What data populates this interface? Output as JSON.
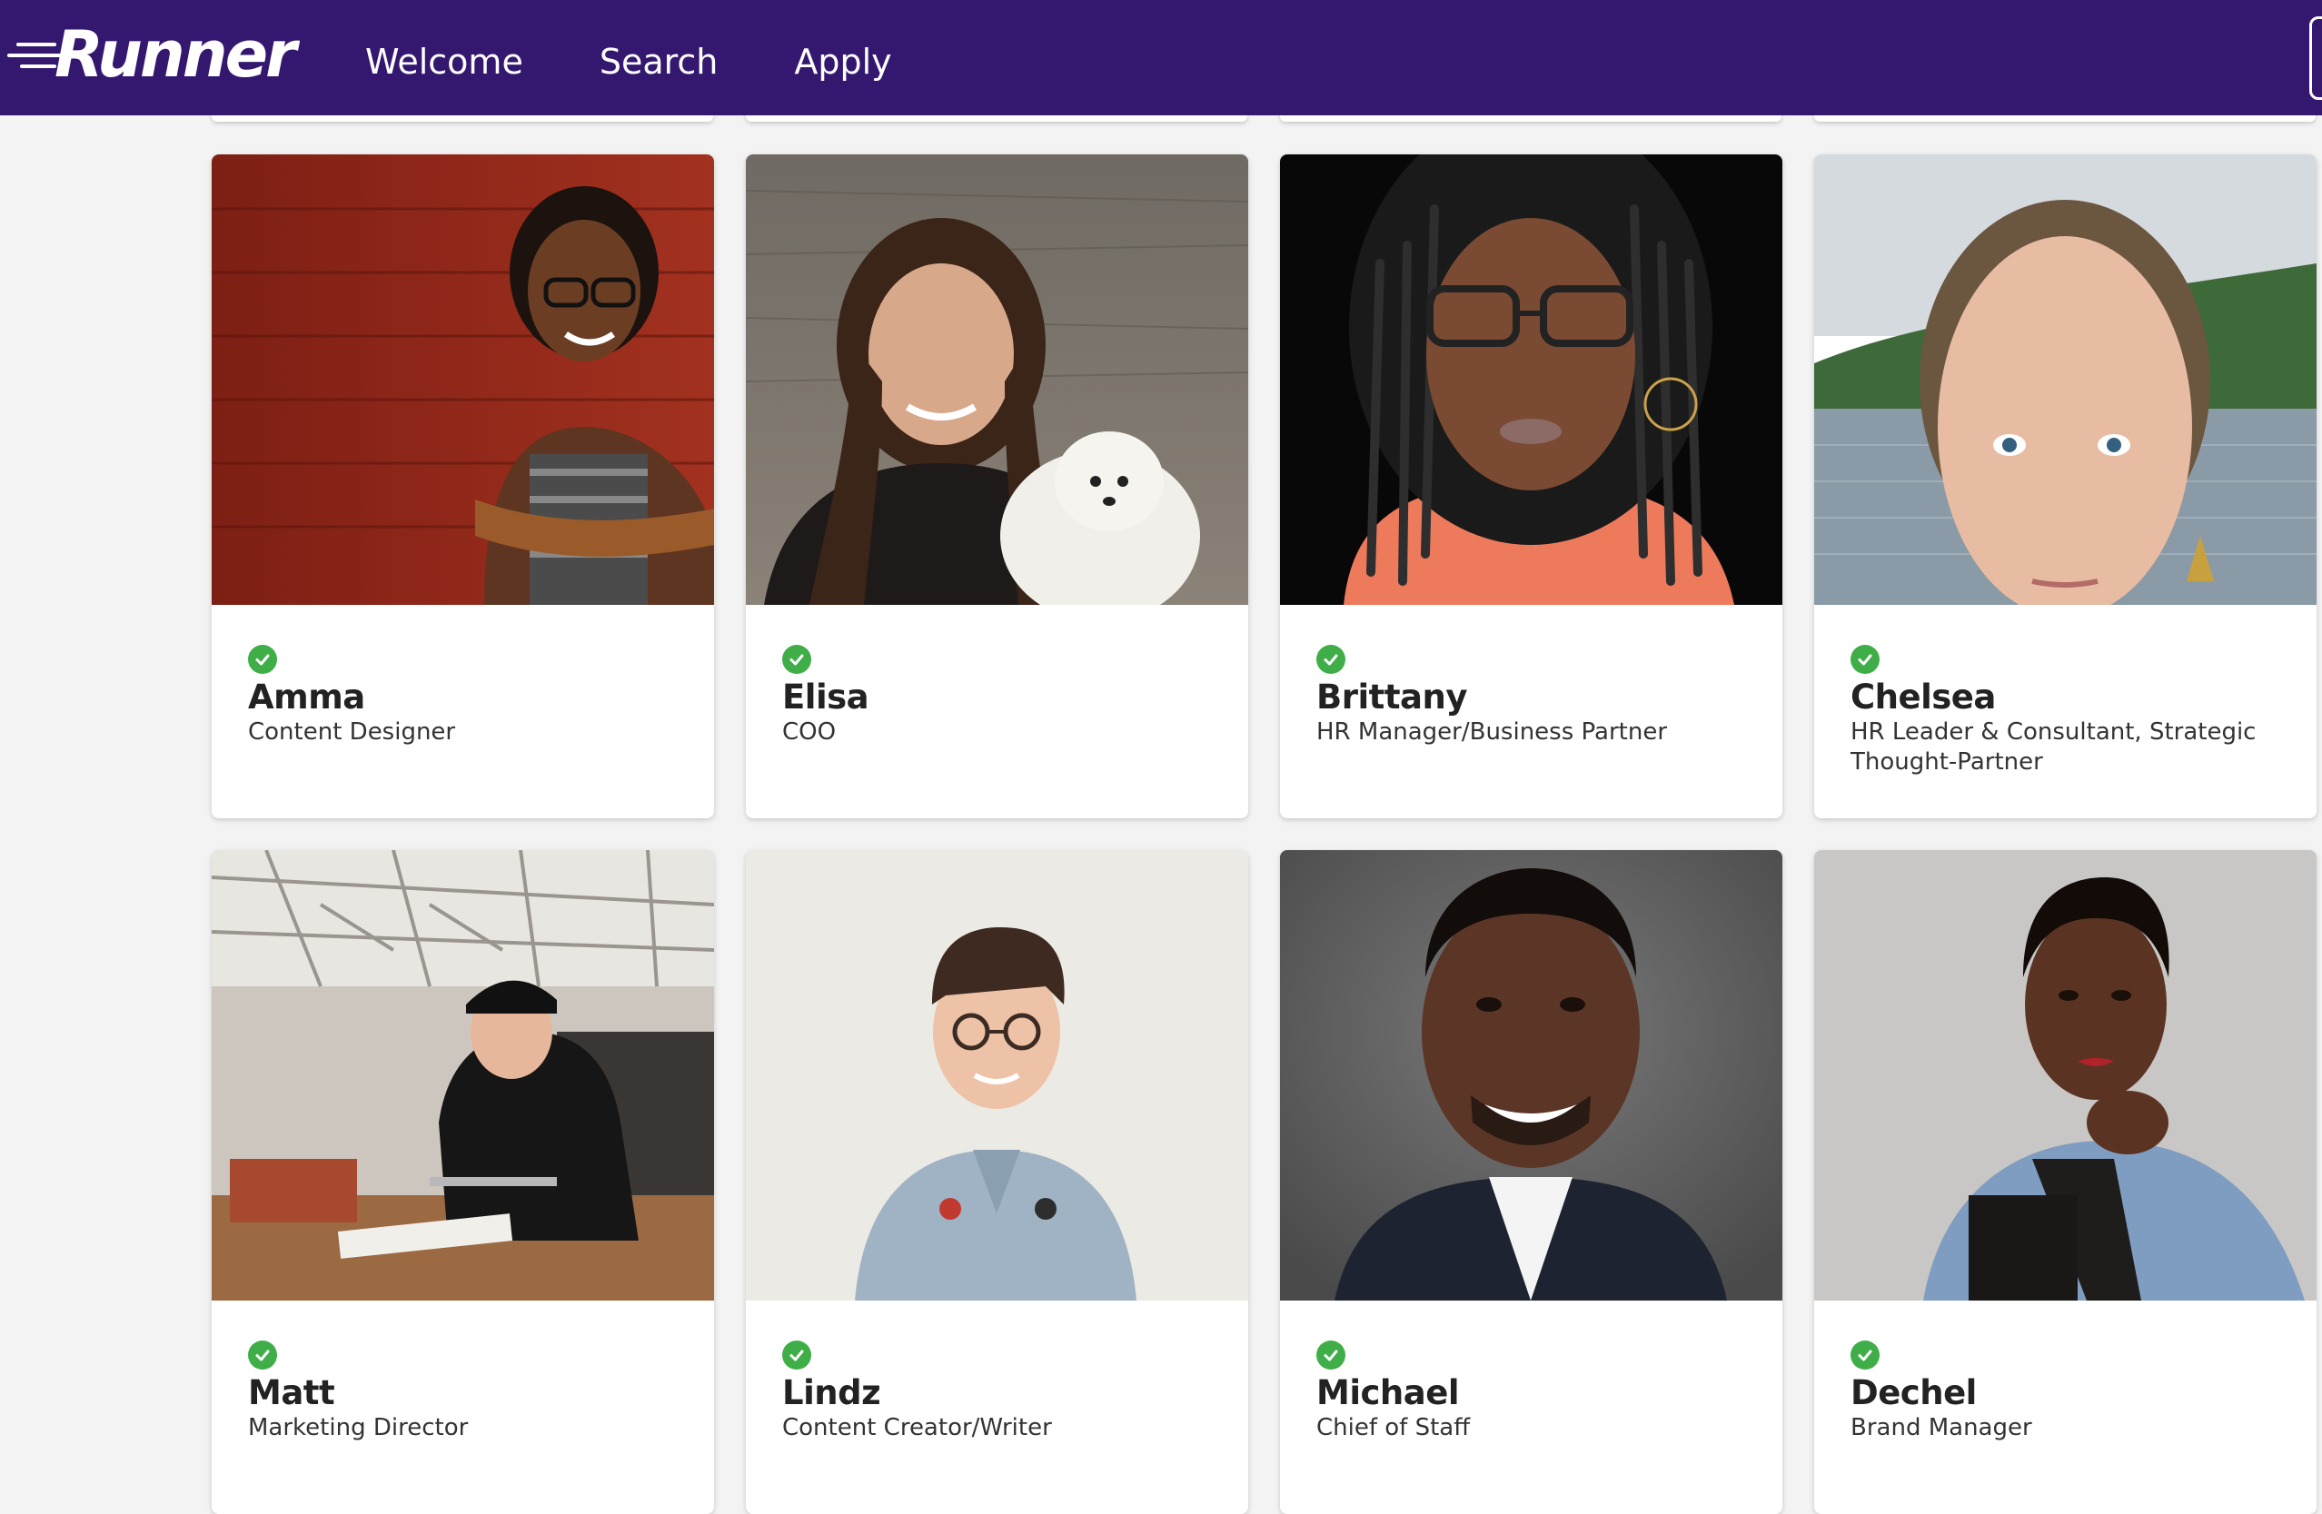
{
  "header": {
    "logo_text": "Runner",
    "nav": [
      {
        "label": "Welcome"
      },
      {
        "label": "Search"
      },
      {
        "label": "Apply"
      }
    ],
    "bg_color": "#341870"
  },
  "verified_icon": "check-circle-icon",
  "verified_color": "#3fae49",
  "profiles": [
    {
      "name": "Amma",
      "role": "Content Designer"
    },
    {
      "name": "Elisa",
      "role": "COO"
    },
    {
      "name": "Brittany",
      "role": "HR Manager/Business Partner"
    },
    {
      "name": "Chelsea",
      "role": "HR Leader & Consultant, Strategic Thought-Partner"
    },
    {
      "name": "Matt",
      "role": "Marketing Director"
    },
    {
      "name": "Lindz",
      "role": "Content Creator/Writer"
    },
    {
      "name": "Michael",
      "role": "Chief of Staff"
    },
    {
      "name": "Dechel",
      "role": "Brand Manager"
    }
  ]
}
